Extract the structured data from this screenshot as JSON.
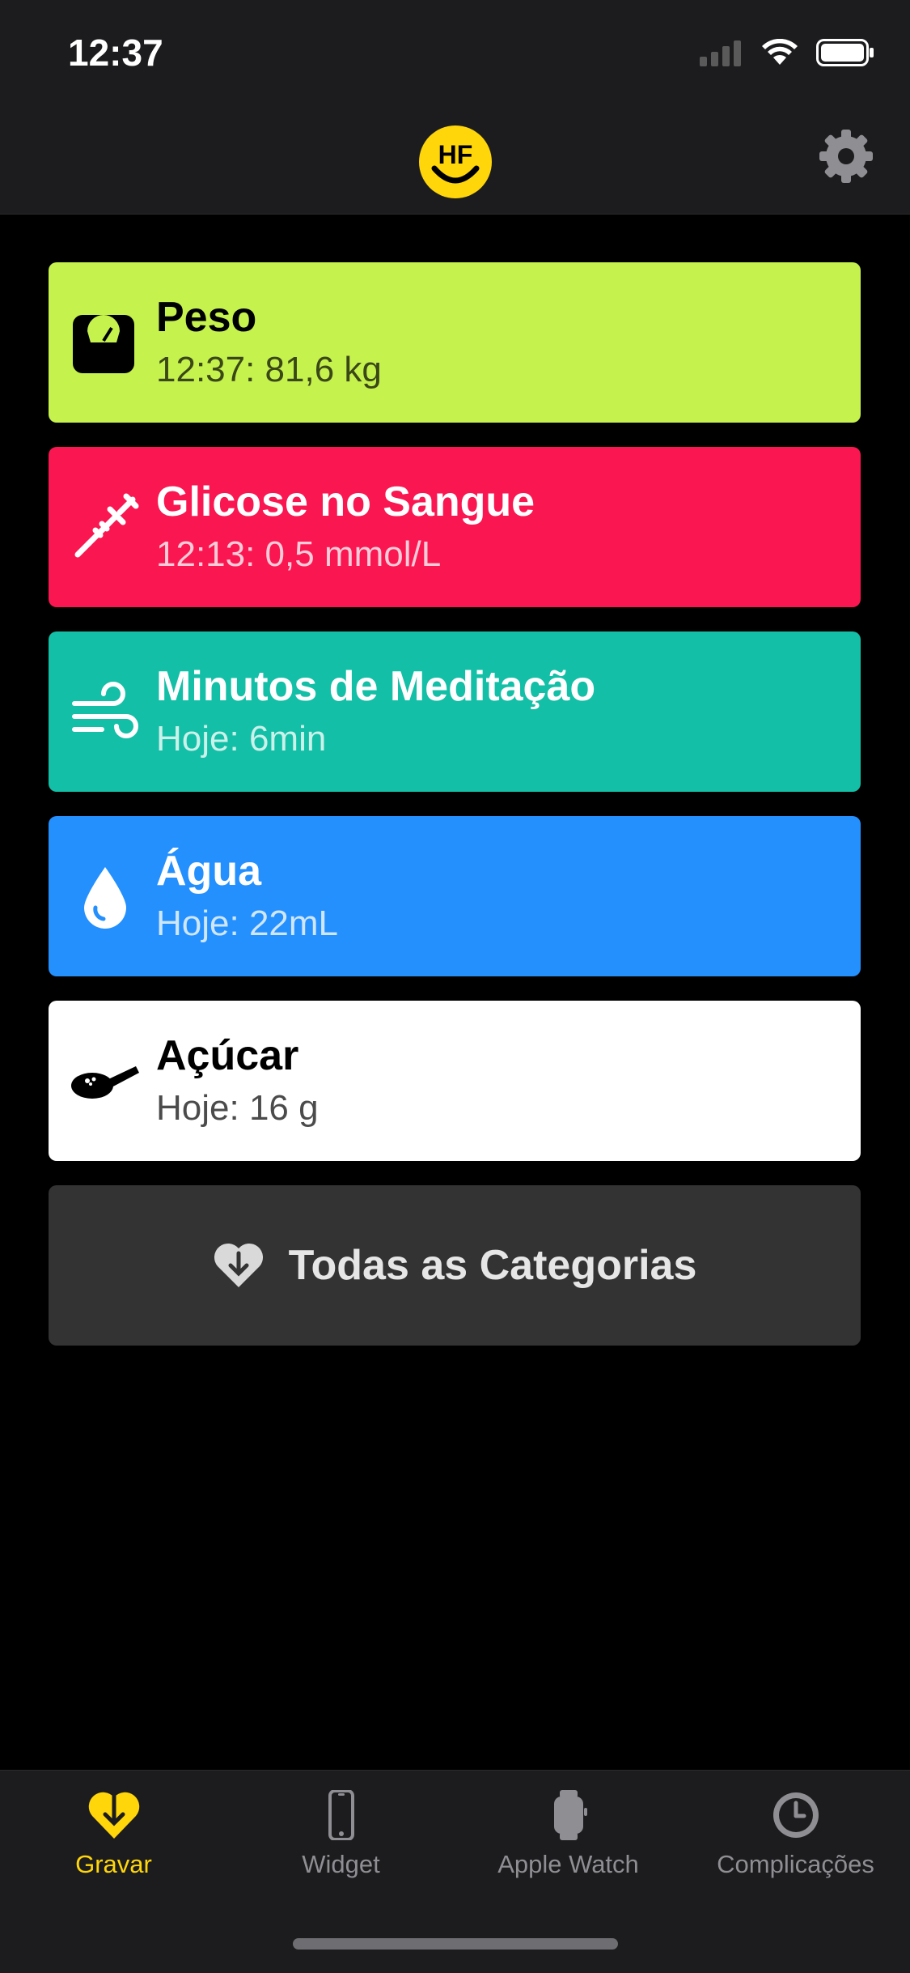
{
  "status_bar": {
    "time": "12:37"
  },
  "header": {
    "logo_text": "HF",
    "settings_icon": "gear-icon"
  },
  "cards": [
    {
      "title": "Peso",
      "subtitle": "12:37: 81,6 kg",
      "icon": "scale-icon",
      "bg": "#c6f24e",
      "fg": "#000000"
    },
    {
      "title": "Glicose no Sangue",
      "subtitle": "12:13: 0,5 mmol/L",
      "icon": "syringe-icon",
      "bg": "#fa1650",
      "fg": "#ffffff"
    },
    {
      "title": "Minutos de Meditação",
      "subtitle": "Hoje: 6min",
      "icon": "wind-icon",
      "bg": "#13bfa6",
      "fg": "#ffffff"
    },
    {
      "title": "Água",
      "subtitle": "Hoje: 22mL",
      "icon": "water-drop-icon",
      "bg": "#2490fd",
      "fg": "#ffffff"
    },
    {
      "title": "Açúcar",
      "subtitle": "Hoje: 16 g",
      "icon": "sugar-spoon-icon",
      "bg": "#ffffff",
      "fg": "#000000"
    }
  ],
  "all_categories": {
    "label": "Todas as Categorias",
    "icon": "heart-download-icon"
  },
  "tabs": [
    {
      "label": "Gravar",
      "icon": "heart-download-icon",
      "active": true
    },
    {
      "label": "Widget",
      "icon": "phone-icon",
      "active": false
    },
    {
      "label": "Apple Watch",
      "icon": "watch-icon",
      "active": false
    },
    {
      "label": "Complicações",
      "icon": "clock-icon",
      "active": false
    }
  ],
  "colors": {
    "accent": "#ffd60a",
    "background": "#000000",
    "bar": "#1c1c1e"
  }
}
